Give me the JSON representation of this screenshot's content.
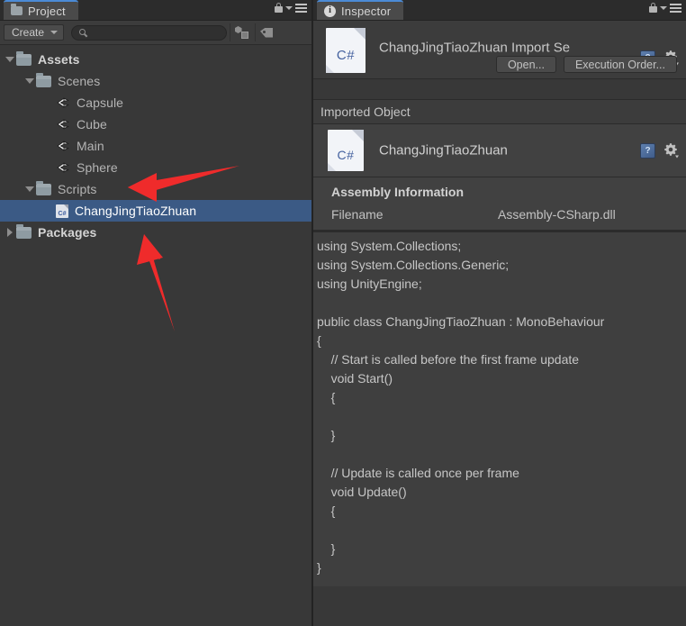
{
  "project": {
    "tab_label": "Project",
    "tab_icon": "folder-icon",
    "lock_icon": "lock-icon",
    "menu_icon": "hamburger-menu-icon",
    "toolbar": {
      "create_label": "Create",
      "search_value": "",
      "search_placeholder": "",
      "search_icon": "search-icon",
      "asset_filter_icon": "asset-type-filter-icon",
      "label_filter_icon": "label-filter-icon"
    },
    "tree": [
      {
        "label": "Assets",
        "icon": "folder-icon",
        "depth": 0,
        "twisty": "open",
        "selected": false,
        "root": true
      },
      {
        "label": "Scenes",
        "icon": "folder-icon",
        "depth": 1,
        "twisty": "open",
        "selected": false,
        "root": false
      },
      {
        "label": "Capsule",
        "icon": "unity-scene-icon",
        "depth": 2,
        "twisty": "none",
        "selected": false,
        "root": false
      },
      {
        "label": "Cube",
        "icon": "unity-scene-icon",
        "depth": 2,
        "twisty": "none",
        "selected": false,
        "root": false
      },
      {
        "label": "Main",
        "icon": "unity-scene-icon",
        "depth": 2,
        "twisty": "none",
        "selected": false,
        "root": false
      },
      {
        "label": "Sphere",
        "icon": "unity-scene-icon",
        "depth": 2,
        "twisty": "none",
        "selected": false,
        "root": false
      },
      {
        "label": "Scripts",
        "icon": "folder-icon",
        "depth": 1,
        "twisty": "open",
        "selected": false,
        "root": false
      },
      {
        "label": "ChangJingTiaoZhuan",
        "icon": "csharp-file-icon",
        "depth": 2,
        "twisty": "none",
        "selected": true,
        "root": false
      },
      {
        "label": "Packages",
        "icon": "folder-icon",
        "depth": 0,
        "twisty": "closed",
        "selected": false,
        "root": true
      }
    ]
  },
  "inspector": {
    "tab_label": "Inspector",
    "tab_icon": "info-icon",
    "lock_icon": "lock-icon",
    "menu_icon": "hamburger-menu-icon",
    "header": {
      "title": "ChangJingTiaoZhuan Import Se",
      "file_icon": "csharp-file-icon",
      "help_icon": "help-book-icon",
      "gear_icon": "gear-icon",
      "open_button": "Open...",
      "execution_order_button": "Execution Order..."
    },
    "imported_object": {
      "section_title": "Imported Object",
      "name": "ChangJingTiaoZhuan",
      "file_icon": "csharp-file-icon",
      "help_icon": "help-book-icon",
      "gear_icon": "gear-icon"
    },
    "assembly_information": {
      "title": "Assembly Information",
      "filename_label": "Filename",
      "filename_value": "Assembly-CSharp.dll"
    },
    "code_preview": "using System.Collections;\nusing System.Collections.Generic;\nusing UnityEngine;\n\npublic class ChangJingTiaoZhuan : MonoBehaviour\n{\n    // Start is called before the first frame update\n    void Start()\n    {\n        \n    }\n\n    // Update is called once per frame\n    void Update()\n    {\n        \n    }\n}"
  },
  "annotations": {
    "arrow_color": "#ef2b2b",
    "arrow_1": "arrow-pointing-at-scripts-folder",
    "arrow_2": "arrow-pointing-at-changjingtiaozhuan-script"
  },
  "colors": {
    "panel_bg": "#383838",
    "toolbar_bg": "#3c3c3c",
    "tab_active_bg": "#4a4a4a",
    "tab_accent": "#4b8bd6",
    "selection_blue": "#3b5a85",
    "code_bg": "#3f3f3f",
    "text_primary": "#c6c6c6"
  }
}
